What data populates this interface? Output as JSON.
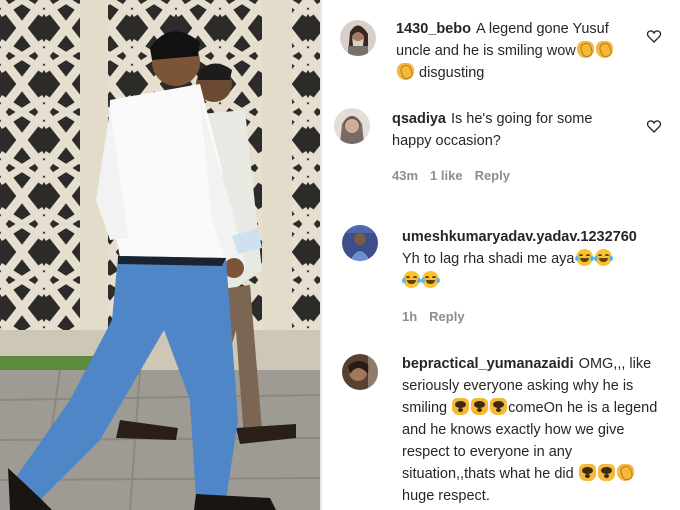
{
  "comments": [
    {
      "username": "1430_bebo",
      "text_parts": [
        "A legend gone Yusuf uncle and he is smiling wow",
        " disgusting"
      ],
      "avatar_color": "#8a6f63",
      "has_like_icon": true
    },
    {
      "username": "qsadiya",
      "text": "Is he's going for some happy occasion?",
      "time": "43m",
      "likes": "1 like",
      "reply": "Reply",
      "avatar_color": "#b7a59b",
      "has_like_icon": true
    },
    {
      "username": "umeshkumaryadav.yadav.1232760",
      "text": "Yh to lag rha shadi me aya",
      "time": "1h",
      "reply": "Reply",
      "avatar_color": "#3e4d8c"
    },
    {
      "username": "bepractical_yumanazaidi",
      "text_parts": [
        "OMG,,, like seriously everyone asking why he is smiling ",
        "comeOn he is a legend and he knows exactly how we give respect to everyone in any situation,,thats what he did ",
        "huge respect."
      ],
      "avatar_color": "#5a4030"
    }
  ],
  "icons": {
    "like": "heart-outline-icon",
    "clap": "clapping-hands-emoji",
    "laugh": "tears-of-joy-emoji",
    "hands": "raised-hands-emoji"
  },
  "colors": {
    "text": "#262626",
    "meta": "#8e8e8e"
  }
}
